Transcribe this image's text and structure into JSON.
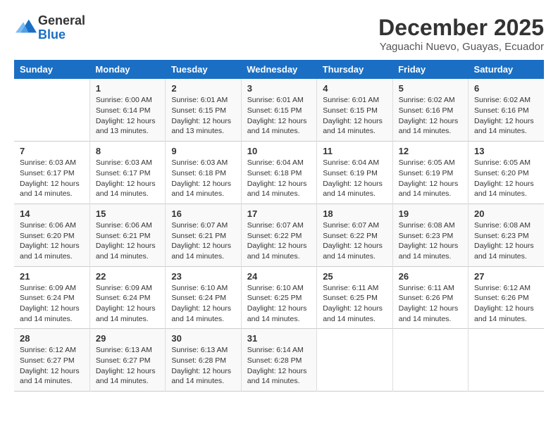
{
  "logo": {
    "general": "General",
    "blue": "Blue"
  },
  "title": "December 2025",
  "subtitle": "Yaguachi Nuevo, Guayas, Ecuador",
  "days_header": [
    "Sunday",
    "Monday",
    "Tuesday",
    "Wednesday",
    "Thursday",
    "Friday",
    "Saturday"
  ],
  "weeks": [
    [
      {
        "day": "",
        "info": ""
      },
      {
        "day": "1",
        "info": "Sunrise: 6:00 AM\nSunset: 6:14 PM\nDaylight: 12 hours\nand 13 minutes."
      },
      {
        "day": "2",
        "info": "Sunrise: 6:01 AM\nSunset: 6:15 PM\nDaylight: 12 hours\nand 13 minutes."
      },
      {
        "day": "3",
        "info": "Sunrise: 6:01 AM\nSunset: 6:15 PM\nDaylight: 12 hours\nand 14 minutes."
      },
      {
        "day": "4",
        "info": "Sunrise: 6:01 AM\nSunset: 6:15 PM\nDaylight: 12 hours\nand 14 minutes."
      },
      {
        "day": "5",
        "info": "Sunrise: 6:02 AM\nSunset: 6:16 PM\nDaylight: 12 hours\nand 14 minutes."
      },
      {
        "day": "6",
        "info": "Sunrise: 6:02 AM\nSunset: 6:16 PM\nDaylight: 12 hours\nand 14 minutes."
      }
    ],
    [
      {
        "day": "7",
        "info": "Sunrise: 6:03 AM\nSunset: 6:17 PM\nDaylight: 12 hours\nand 14 minutes."
      },
      {
        "day": "8",
        "info": "Sunrise: 6:03 AM\nSunset: 6:17 PM\nDaylight: 12 hours\nand 14 minutes."
      },
      {
        "day": "9",
        "info": "Sunrise: 6:03 AM\nSunset: 6:18 PM\nDaylight: 12 hours\nand 14 minutes."
      },
      {
        "day": "10",
        "info": "Sunrise: 6:04 AM\nSunset: 6:18 PM\nDaylight: 12 hours\nand 14 minutes."
      },
      {
        "day": "11",
        "info": "Sunrise: 6:04 AM\nSunset: 6:19 PM\nDaylight: 12 hours\nand 14 minutes."
      },
      {
        "day": "12",
        "info": "Sunrise: 6:05 AM\nSunset: 6:19 PM\nDaylight: 12 hours\nand 14 minutes."
      },
      {
        "day": "13",
        "info": "Sunrise: 6:05 AM\nSunset: 6:20 PM\nDaylight: 12 hours\nand 14 minutes."
      }
    ],
    [
      {
        "day": "14",
        "info": "Sunrise: 6:06 AM\nSunset: 6:20 PM\nDaylight: 12 hours\nand 14 minutes."
      },
      {
        "day": "15",
        "info": "Sunrise: 6:06 AM\nSunset: 6:21 PM\nDaylight: 12 hours\nand 14 minutes."
      },
      {
        "day": "16",
        "info": "Sunrise: 6:07 AM\nSunset: 6:21 PM\nDaylight: 12 hours\nand 14 minutes."
      },
      {
        "day": "17",
        "info": "Sunrise: 6:07 AM\nSunset: 6:22 PM\nDaylight: 12 hours\nand 14 minutes."
      },
      {
        "day": "18",
        "info": "Sunrise: 6:07 AM\nSunset: 6:22 PM\nDaylight: 12 hours\nand 14 minutes."
      },
      {
        "day": "19",
        "info": "Sunrise: 6:08 AM\nSunset: 6:23 PM\nDaylight: 12 hours\nand 14 minutes."
      },
      {
        "day": "20",
        "info": "Sunrise: 6:08 AM\nSunset: 6:23 PM\nDaylight: 12 hours\nand 14 minutes."
      }
    ],
    [
      {
        "day": "21",
        "info": "Sunrise: 6:09 AM\nSunset: 6:24 PM\nDaylight: 12 hours\nand 14 minutes."
      },
      {
        "day": "22",
        "info": "Sunrise: 6:09 AM\nSunset: 6:24 PM\nDaylight: 12 hours\nand 14 minutes."
      },
      {
        "day": "23",
        "info": "Sunrise: 6:10 AM\nSunset: 6:24 PM\nDaylight: 12 hours\nand 14 minutes."
      },
      {
        "day": "24",
        "info": "Sunrise: 6:10 AM\nSunset: 6:25 PM\nDaylight: 12 hours\nand 14 minutes."
      },
      {
        "day": "25",
        "info": "Sunrise: 6:11 AM\nSunset: 6:25 PM\nDaylight: 12 hours\nand 14 minutes."
      },
      {
        "day": "26",
        "info": "Sunrise: 6:11 AM\nSunset: 6:26 PM\nDaylight: 12 hours\nand 14 minutes."
      },
      {
        "day": "27",
        "info": "Sunrise: 6:12 AM\nSunset: 6:26 PM\nDaylight: 12 hours\nand 14 minutes."
      }
    ],
    [
      {
        "day": "28",
        "info": "Sunrise: 6:12 AM\nSunset: 6:27 PM\nDaylight: 12 hours\nand 14 minutes."
      },
      {
        "day": "29",
        "info": "Sunrise: 6:13 AM\nSunset: 6:27 PM\nDaylight: 12 hours\nand 14 minutes."
      },
      {
        "day": "30",
        "info": "Sunrise: 6:13 AM\nSunset: 6:28 PM\nDaylight: 12 hours\nand 14 minutes."
      },
      {
        "day": "31",
        "info": "Sunrise: 6:14 AM\nSunset: 6:28 PM\nDaylight: 12 hours\nand 14 minutes."
      },
      {
        "day": "",
        "info": ""
      },
      {
        "day": "",
        "info": ""
      },
      {
        "day": "",
        "info": ""
      }
    ]
  ]
}
